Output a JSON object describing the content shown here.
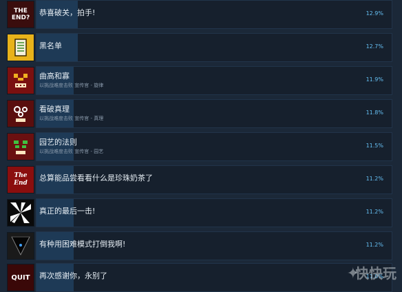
{
  "achievements": [
    {
      "icon": "the-end-text-icon",
      "icon_label": "THE END?",
      "title": "恭喜破关，拍手!",
      "desc": "",
      "pct": "12.9%",
      "rate": 12.9
    },
    {
      "icon": "blacklist-icon",
      "icon_label": "",
      "title": "黑名单",
      "desc": "",
      "pct": "12.7%",
      "rate": 12.7
    },
    {
      "icon": "pixel-skull-icon",
      "icon_label": "",
      "title": "曲高和寡",
      "desc": "以挑战难度击败 宣传官 - 旋律",
      "pct": "11.9%",
      "rate": 11.9
    },
    {
      "icon": "eyes-skull-icon",
      "icon_label": "",
      "title": "看破真理",
      "desc": "以挑战难度击败 宣传官 - 真理",
      "pct": "11.8%",
      "rate": 11.8
    },
    {
      "icon": "green-skull-icon",
      "icon_label": "",
      "title": "园艺的法则",
      "desc": "以挑战难度击败 宣传官 - 园艺",
      "pct": "11.5%",
      "rate": 11.5
    },
    {
      "icon": "the-end-script-icon",
      "icon_label": "The End",
      "title": "总算能品尝看看什么是珍珠奶茶了",
      "desc": "",
      "pct": "11.2%",
      "rate": 11.2
    },
    {
      "icon": "burst-icon",
      "icon_label": "",
      "title": "真正的最后一击!",
      "desc": "",
      "pct": "11.2%",
      "rate": 11.2
    },
    {
      "icon": "dark-triangle-icon",
      "icon_label": "",
      "title": "有种用困难模式打倒我啊!",
      "desc": "",
      "pct": "11.2%",
      "rate": 11.2
    },
    {
      "icon": "quit-icon",
      "icon_label": "QUIT",
      "title": "再次感谢你，永别了",
      "desc": "",
      "pct": "11.0%",
      "rate": 11.0
    }
  ],
  "watermark": "快快玩",
  "colors": {
    "bg": "#1b2838",
    "fill": "#1e3a56",
    "pct": "#66c0f4"
  }
}
